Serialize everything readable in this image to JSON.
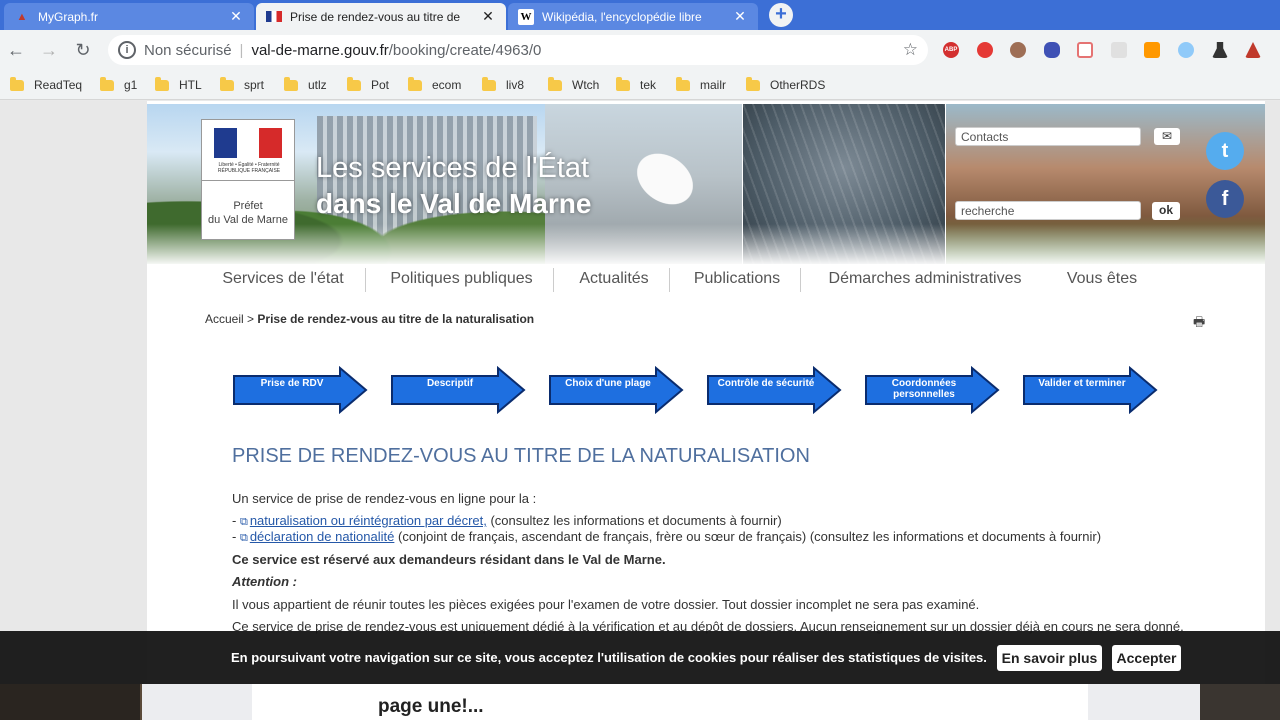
{
  "tabs": [
    {
      "title": "MyGraph.fr",
      "icon": "mygraph-icon",
      "active": false
    },
    {
      "title": "Prise de rendez-vous au titre de",
      "icon": "french-flag-icon",
      "active": true
    },
    {
      "title": "Wikipédia, l'encyclopédie libre",
      "icon": "wikipedia-icon",
      "active": false
    }
  ],
  "address": {
    "security": "Non sécurisé",
    "host": "val-de-marne.gouv.fr",
    "path": "/booking/create/4963/0"
  },
  "bookmarks": [
    "ReadTeq",
    "g1",
    "HTL",
    "sprt",
    "utlz",
    "Pot",
    "ecom",
    "liv8",
    "Wtch",
    "tek",
    "mailr",
    "OtherRDS"
  ],
  "header": {
    "logo_small": "Liberté • Égalité • Fraternité RÉPUBLIQUE FRANÇAISE",
    "prefet_line1": "Préfet",
    "prefet_line2": "du Val de Marne",
    "headline": "Les services de l'État",
    "headline2": "dans le Val de Marne",
    "contacts_placeholder": "Contacts",
    "search_placeholder": "recherche",
    "ok_label": "ok",
    "twitter": "t",
    "facebook": "f"
  },
  "menu": [
    "Services de l'état",
    "Politiques publiques",
    "Actualités",
    "Publications",
    "Démarches administratives",
    "Vous êtes"
  ],
  "breadcrumb": {
    "home": "Accueil",
    "sep": ">",
    "current": "Prise de rendez-vous au titre de la naturalisation"
  },
  "steps": [
    "Prise de RDV",
    "Descriptif",
    "Choix d'une plage",
    "Contrôle de sécurité",
    "Coordonnées personnelles",
    "Valider et terminer"
  ],
  "main": {
    "title": "PRISE DE RENDEZ-VOUS AU TITRE DE LA NATURALISATION",
    "intro": "Un service de prise de rendez-vous en ligne pour la  :",
    "item1_link": "naturalisation ou réintégration par décret,",
    "item1_rest": " (consultez les informations et documents à fournir)",
    "item2_link": "déclaration de nationalité",
    "item2_rest": " (conjoint de français, ascendant de français, frère ou sœur de français) (consultez les informations et documents à fournir)",
    "reserved": "Ce service est réservé aux demandeurs résidant dans le Val de Marne.",
    "attention": "Attention  :",
    "para1": " Il vous appartient de réunir toutes les pièces exigées pour l'examen de votre dossier. Tout dossier incomplet ne sera pas examiné.",
    "para2": "Ce service de prise de rendez-vous est uniquement dédié à la vérification et au dépôt de dossiers. Aucun renseignement sur un dossier déjà en cours ne sera donné."
  },
  "cookie": {
    "message": "En poursuivant votre navigation sur ce site, vous acceptez l'utilisation de cookies pour réaliser des statistiques de visites.",
    "more": "En savoir plus",
    "accept": "Accepter"
  },
  "overlay_text": "page une!...",
  "colors": {
    "tabbar": "#3c6fd6",
    "step_blue": "#1e6fe0",
    "title_blue": "#4f6f9e",
    "link": "#2558a8"
  }
}
